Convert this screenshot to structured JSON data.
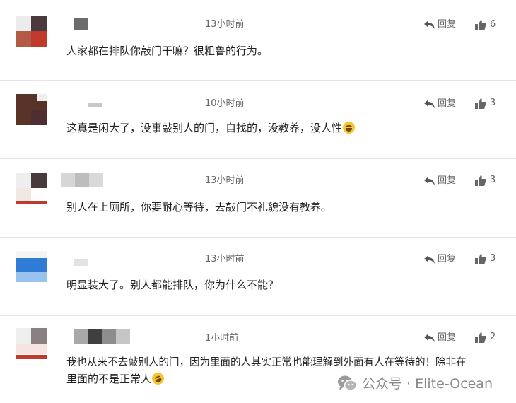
{
  "comments": [
    {
      "time": "13小时前",
      "reply_label": "回复",
      "likes": "6",
      "text": "人家都在排队你敲门干嘛？很粗鲁的行为。"
    },
    {
      "time": "10小时前",
      "reply_label": "回复",
      "likes": "3",
      "text": "这真是闲大了，没事敲别人的门，自找的，没教养，没人性",
      "emoji": "laughing-crying-emoji"
    },
    {
      "time": "13小时前",
      "reply_label": "回复",
      "likes": "3",
      "text": "别人在上厕所，你要耐心等待，去敲门不礼貌没有教养。"
    },
    {
      "time": "13小时前",
      "reply_label": "回复",
      "likes": "3",
      "text": "明显装大了。别人都能排队，你为什么不能？"
    },
    {
      "time": "1小时前",
      "reply_label": "回复",
      "likes": "2",
      "text_line1": "我也从来不去敲别人的门，因为里面的人其实正常也能理解到外面有人在等待的！除非在",
      "text_line2": "里面的不是正常人",
      "emoji": "rofl-emoji"
    }
  ],
  "watermark": "公众号 · Elite-Ocean",
  "colors": {
    "meta_text": "#666666",
    "comment_text": "#222222",
    "divider": "#e4e4e4",
    "emoji": "#f7c531"
  }
}
